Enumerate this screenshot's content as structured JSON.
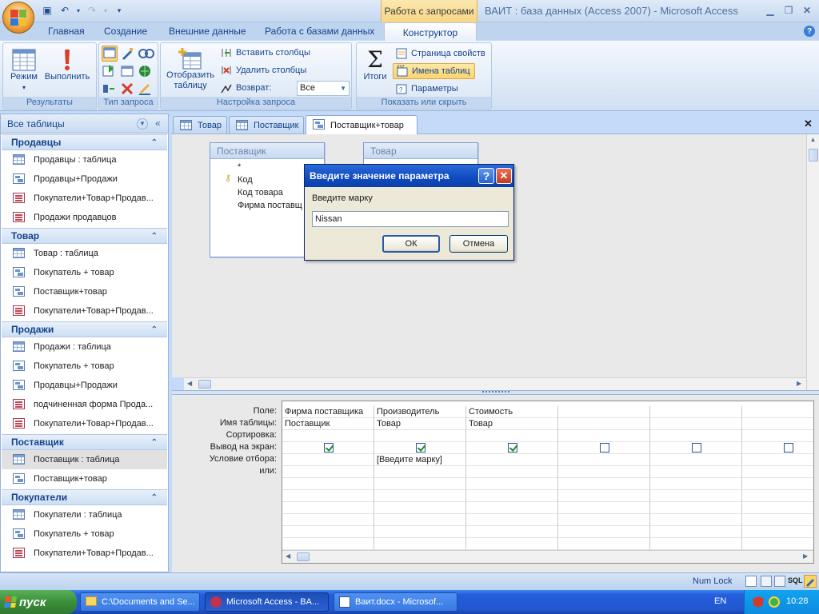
{
  "title": {
    "context_tab": "Работа с запросами",
    "app_title": "ВАИТ : база данных (Access 2007) - Microsoft Access"
  },
  "ribbon_tabs": [
    "Главная",
    "Создание",
    "Внешние данные",
    "Работа с базами данных",
    "Конструктор"
  ],
  "ribbon": {
    "results": {
      "label": "Результаты",
      "mode": "Режим",
      "run": "Выполнить"
    },
    "query_type": {
      "label": "Тип запроса"
    },
    "setup": {
      "label": "Настройка запроса",
      "show_table": "Отобразить таблицу",
      "insert_cols": "Вставить столбцы",
      "delete_cols": "Удалить столбцы",
      "return_label": "Возврат:",
      "return_value": "Все"
    },
    "show_hide": {
      "label": "Показать или скрыть",
      "totals": "Итоги",
      "props": "Страница свойств",
      "table_names": "Имена таблиц",
      "params": "Параметры"
    }
  },
  "nav": {
    "header": "Все таблицы",
    "groups": [
      {
        "name": "Продавцы",
        "items": [
          {
            "label": "Продавцы : таблица",
            "icon": "table"
          },
          {
            "label": "Продавцы+Продажи",
            "icon": "query"
          },
          {
            "label": "Покупатели+Товар+Продав...",
            "icon": "form"
          },
          {
            "label": "Продажи продавцов",
            "icon": "form"
          }
        ]
      },
      {
        "name": "Товар",
        "items": [
          {
            "label": "Товар : таблица",
            "icon": "table"
          },
          {
            "label": "Покупатель + товар",
            "icon": "query"
          },
          {
            "label": "Поставщик+товар",
            "icon": "query"
          },
          {
            "label": "Покупатели+Товар+Продав...",
            "icon": "form"
          }
        ]
      },
      {
        "name": "Продажи",
        "items": [
          {
            "label": "Продажи : таблица",
            "icon": "table"
          },
          {
            "label": "Покупатель + товар",
            "icon": "query"
          },
          {
            "label": "Продавцы+Продажи",
            "icon": "query"
          },
          {
            "label": "подчиненная форма Прода...",
            "icon": "form"
          },
          {
            "label": "Покупатели+Товар+Продав...",
            "icon": "form"
          }
        ]
      },
      {
        "name": "Поставщик",
        "items": [
          {
            "label": "Поставщик : таблица",
            "icon": "table"
          },
          {
            "label": "Поставщик+товар",
            "icon": "query"
          }
        ]
      },
      {
        "name": "Покупатели",
        "items": [
          {
            "label": "Покупатели : таблица",
            "icon": "table"
          },
          {
            "label": "Покупатель + товар",
            "icon": "query"
          },
          {
            "label": "Покупатели+Товар+Продав...",
            "icon": "form"
          }
        ]
      }
    ]
  },
  "doc_tabs": [
    "Товар",
    "Поставщик",
    "Поставщик+товар"
  ],
  "tables": {
    "supplier": {
      "title": "Поставщик",
      "fields": [
        "*",
        "Код",
        "Код товара",
        "Фирма поставщ"
      ]
    },
    "product": {
      "title": "Товар"
    }
  },
  "grid": {
    "row_labels": [
      "Поле:",
      "Имя таблицы:",
      "Сортировка:",
      "Вывод на экран:",
      "Условие отбора:",
      "или:"
    ],
    "columns": [
      {
        "field": "Фирма поставщика",
        "table": "Поставщик",
        "show": true,
        "criteria": ""
      },
      {
        "field": "Производитель",
        "table": "Товар",
        "show": true,
        "criteria": "[Введите марку]"
      },
      {
        "field": "Стоимость",
        "table": "Товар",
        "show": true,
        "criteria": ""
      },
      {
        "field": "",
        "table": "",
        "show": false,
        "criteria": ""
      },
      {
        "field": "",
        "table": "",
        "show": false,
        "criteria": ""
      },
      {
        "field": "",
        "table": "",
        "show": false,
        "criteria": ""
      }
    ]
  },
  "dialog": {
    "title": "Введите значение параметра",
    "prompt": "Введите марку",
    "value": "Nissan",
    "ok": "ОК",
    "cancel": "Отмена"
  },
  "status": {
    "num_lock": "Num Lock",
    "sql": "SQL"
  },
  "taskbar": {
    "start": "пуск",
    "tasks": [
      "C:\\Documents and Se...",
      "Microsoft Access - BA...",
      "Ваит.docx - Microsof..."
    ],
    "lang": "EN",
    "clock": "10:28"
  }
}
